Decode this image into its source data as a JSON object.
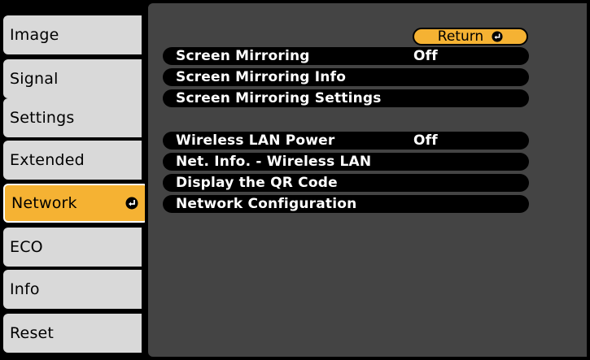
{
  "tabs": [
    {
      "label": "Image"
    },
    {
      "label": "Signal"
    },
    {
      "label": "Settings"
    },
    {
      "label": "Extended"
    },
    {
      "label": "Network"
    },
    {
      "label": "ECO"
    },
    {
      "label": "Info"
    },
    {
      "label": "Reset"
    }
  ],
  "selected_tab": "Network",
  "return_label": "Return",
  "items_group1": [
    {
      "label": "Screen Mirroring",
      "value": "Off"
    },
    {
      "label": "Screen Mirroring Info",
      "value": ""
    },
    {
      "label": "Screen Mirroring Settings",
      "value": ""
    }
  ],
  "items_group2": [
    {
      "label": "Wireless LAN Power",
      "value": "Off"
    },
    {
      "label": "Net. Info. - Wireless LAN",
      "value": ""
    },
    {
      "label": "Display the QR Code",
      "value": ""
    },
    {
      "label": "Network Configuration",
      "value": ""
    }
  ],
  "colors": {
    "highlight": "#f5b233",
    "panel_bg": "#444444",
    "tab_bg": "#d9d9d9"
  },
  "icons": {
    "enter": "enter-icon"
  }
}
